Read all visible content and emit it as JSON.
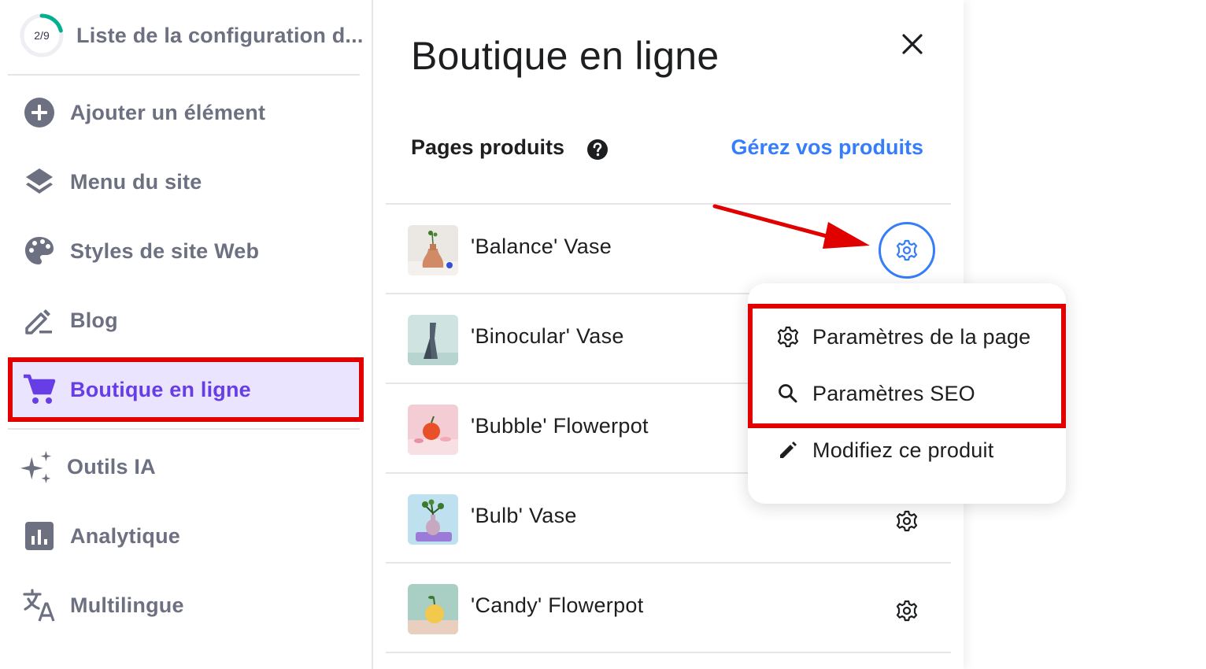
{
  "sidebar": {
    "progress": {
      "label": "2/9",
      "fraction": 0.222
    },
    "checklist_title": "Liste de la configuration d...",
    "items": [
      {
        "label": "Ajouter un élément",
        "icon": "plus-circle-icon"
      },
      {
        "label": "Menu du site",
        "icon": "layers-icon"
      },
      {
        "label": "Styles de site Web",
        "icon": "palette-icon"
      },
      {
        "label": "Blog",
        "icon": "edit-icon"
      },
      {
        "label": "Boutique en ligne",
        "icon": "cart-icon",
        "active": true
      },
      {
        "label": "Outils IA",
        "icon": "sparkle-icon"
      },
      {
        "label": "Analytique",
        "icon": "chart-icon"
      },
      {
        "label": "Multilingue",
        "icon": "translate-icon"
      }
    ]
  },
  "panel": {
    "title": "Boutique en ligne",
    "section_label": "Pages produits",
    "manage_link": "Gérez vos produits",
    "products": [
      {
        "name": "'Balance' Vase"
      },
      {
        "name": "'Binocular' Vase"
      },
      {
        "name": "'Bubble' Flowerpot"
      },
      {
        "name": "'Bulb' Vase"
      },
      {
        "name": "'Candy' Flowerpot"
      }
    ]
  },
  "dropdown": {
    "items": [
      {
        "label": "Paramètres de la page",
        "icon": "gear-icon"
      },
      {
        "label": "Paramètres SEO",
        "icon": "search-icon"
      },
      {
        "label": "Modifiez ce produit",
        "icon": "pencil-icon"
      }
    ]
  },
  "colors": {
    "accent": "#673de6",
    "active_bg": "#ebe4ff",
    "link": "#357df9",
    "annotation": "#e00000",
    "progress_ring": "#00b090"
  }
}
